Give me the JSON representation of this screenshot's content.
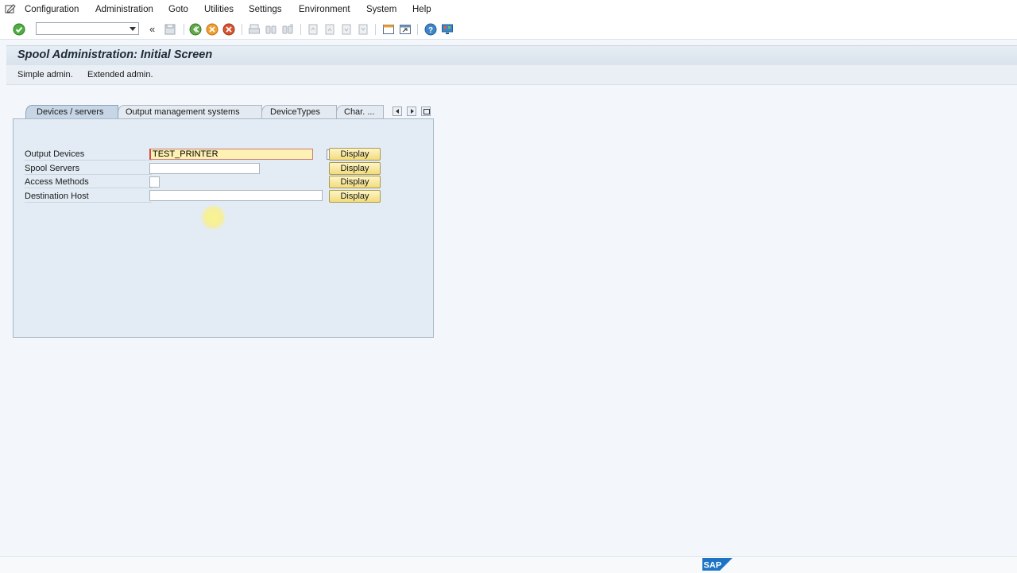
{
  "menubar": {
    "items": [
      "Configuration",
      "Administration",
      "Goto",
      "Utilities",
      "Settings",
      "Environment",
      "System",
      "Help"
    ]
  },
  "toolbar": {
    "command_value": "",
    "back_chevron": "«"
  },
  "window": {
    "title": "Spool Administration: Initial Screen"
  },
  "app_toolbar": {
    "buttons": [
      "Simple admin.",
      "Extended admin."
    ]
  },
  "tabs": {
    "items": [
      "Devices / servers",
      "Output management systems",
      "DeviceTypes",
      "Char. ..."
    ],
    "active": "Devices / servers"
  },
  "form": {
    "rows": [
      {
        "label": "Output Devices",
        "value": "TEST_PRINTER",
        "button": "Display"
      },
      {
        "label": "Spool Servers",
        "value": "",
        "button": "Display"
      },
      {
        "label": "Access Methods",
        "value": "",
        "button": "Display"
      },
      {
        "label": "Destination Host",
        "value": "",
        "button": "Display"
      }
    ]
  },
  "footer": {
    "logo_text": "SAP"
  },
  "colors": {
    "title_bg": "#d9e3ec",
    "panel_bg": "#e3ecf4",
    "button_bg": "#f3dc7c",
    "required_field_bg": "#fdf2b2",
    "logo_blue": "#1d74c5"
  }
}
